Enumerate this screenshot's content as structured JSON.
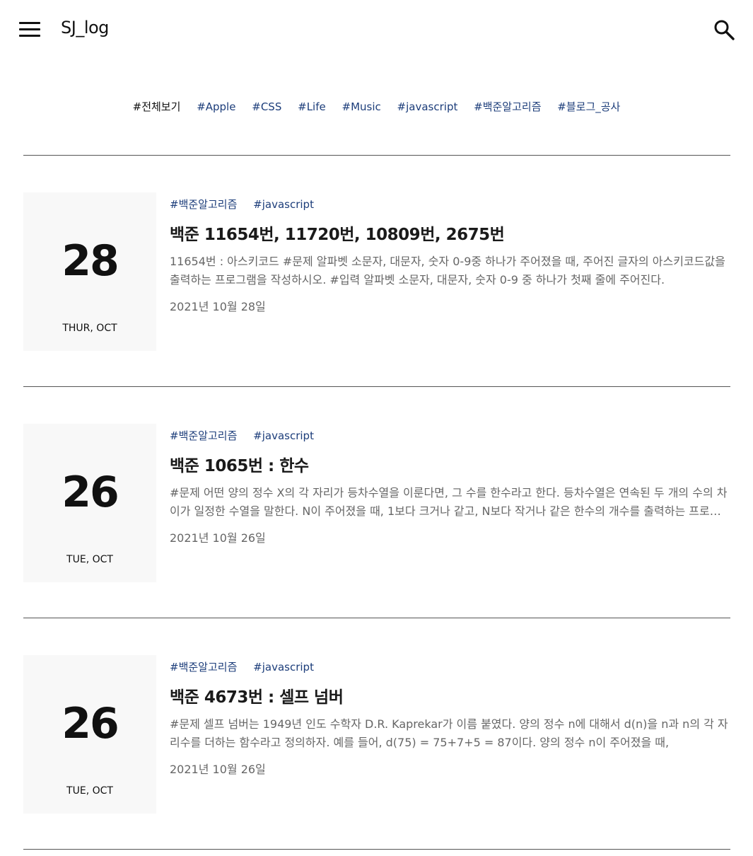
{
  "header": {
    "site_title": "SJ_log"
  },
  "categories": [
    "#전체보기",
    "#Apple",
    "#CSS",
    "#Life",
    "#Music",
    "#javascript",
    "#백준알고리즘",
    "#블로그_공사"
  ],
  "posts": [
    {
      "day": "28",
      "weekday": "THUR, OCT",
      "tags": [
        "#백준알고리즘",
        "#javascript"
      ],
      "title": "백준 11654번, 11720번, 10809번, 2675번",
      "excerpt": "11654번 : 아스키코드 #문제 알파벳 소문자, 대문자, 숫자 0-9중 하나가 주어졌을 때, 주어진 글자의 아스키코드값을 출력하는 프로그램을 작성하시오. #입력 알파벳 소문자, 대문자, 숫자 0-9 중 하나가 첫째 줄에 주어진다.",
      "date": "2021년 10월 28일"
    },
    {
      "day": "26",
      "weekday": "TUE, OCT",
      "tags": [
        "#백준알고리즘",
        "#javascript"
      ],
      "title": "백준 1065번 : 한수",
      "excerpt": "#문제 어떤 양의 정수 X의 각 자리가 등차수열을 이룬다면, 그 수를 한수라고 한다. 등차수열은 연속된 두 개의 수의 차이가 일정한 수열을 말한다. N이 주어졌을 때, 1보다 크거나 같고, N보다 작거나 같은 한수의 개수를 출력하는 프로그램을 작성하시오.",
      "date": "2021년 10월 26일"
    },
    {
      "day": "26",
      "weekday": "TUE, OCT",
      "tags": [
        "#백준알고리즘",
        "#javascript"
      ],
      "title": "백준 4673번 : 셀프 넘버",
      "excerpt": "#문제 셀프 넘버는 1949년 인도 수학자 D.R. Kaprekar가 이름 붙였다. 양의 정수 n에 대해서 d(n)을 n과 n의 각 자리수를 더하는 함수라고 정의하자. 예를 들어, d(75) = 75+7+5 = 87이다. 양의 정수 n이 주어졌을 때,",
      "date": "2021년 10월 26일"
    }
  ]
}
